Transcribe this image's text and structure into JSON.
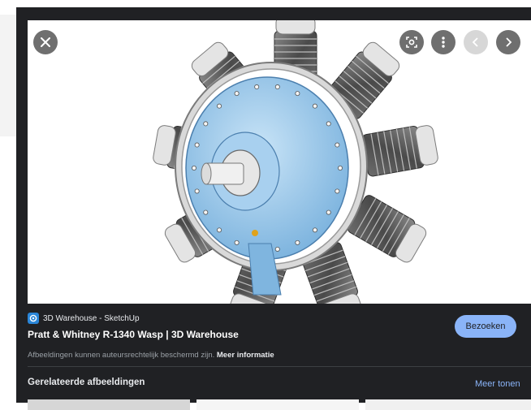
{
  "viewer": {
    "image_alt": "Pratt & Whitney R-1340 Wasp radial engine",
    "buttons": {
      "close": "close-icon",
      "lens": "lens-icon",
      "more": "more-vert-icon",
      "prev": "chevron-left-icon",
      "next": "chevron-right-icon"
    }
  },
  "source": {
    "name": "3D Warehouse - SketchUp",
    "icon": "3d-warehouse-icon"
  },
  "result": {
    "title": "Pratt & Whitney R-1340 Wasp | 3D Warehouse",
    "visit_label": "Bezoeken",
    "copyright_text": "Afbeeldingen kunnen auteursrechtelijk beschermd zijn.",
    "more_info_link": "Meer informatie"
  },
  "related": {
    "heading": "Gerelateerde afbeeldingen",
    "more_label": "Meer tonen"
  },
  "colors": {
    "panel_bg": "#202124",
    "accent": "#8ab4f8",
    "engine_blue": "#8fc3ea"
  }
}
